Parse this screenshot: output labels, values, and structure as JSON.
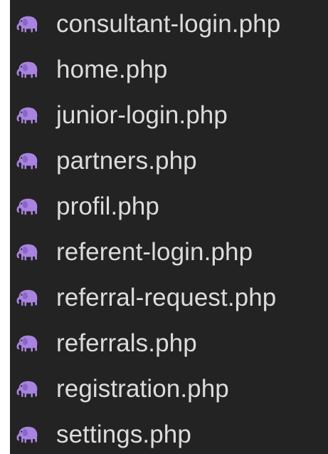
{
  "explorer": {
    "icon_name": "php-elephant-icon",
    "icon_color": "#a884e0",
    "files": [
      {
        "name": "consultant-login.php"
      },
      {
        "name": "home.php"
      },
      {
        "name": "junior-login.php"
      },
      {
        "name": "partners.php"
      },
      {
        "name": "profil.php"
      },
      {
        "name": "referent-login.php"
      },
      {
        "name": "referral-request.php"
      },
      {
        "name": "referrals.php"
      },
      {
        "name": "registration.php"
      },
      {
        "name": "settings.php"
      }
    ]
  }
}
